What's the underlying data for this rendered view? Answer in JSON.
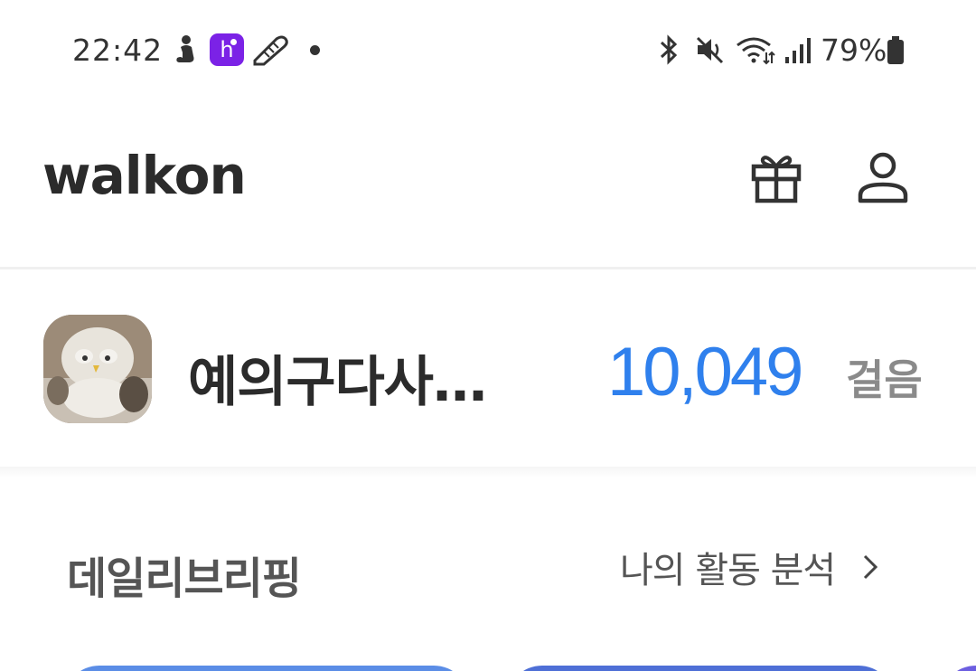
{
  "status_bar": {
    "time": "22:42",
    "notification_icons": [
      "figure-icon",
      "h-app-icon",
      "shoe-icon",
      "dot-icon"
    ],
    "h_app_letter": "h",
    "system_icons": [
      "bluetooth-icon",
      "mute-icon",
      "wifi-icon",
      "signal-icon"
    ],
    "battery_percent": "79%",
    "colors": {
      "h_app": "#7b22e6",
      "text": "#333333"
    }
  },
  "header": {
    "logo": "walkon",
    "icons": [
      "gift-icon",
      "user-icon"
    ]
  },
  "profile": {
    "avatar_alt": "avatar",
    "username": "예의구다사…",
    "steps": "10,049",
    "steps_unit": "걸음",
    "colors": {
      "steps": "#2f80ed"
    }
  },
  "daily_briefing": {
    "title": "데일리브리핑",
    "analysis_link": "나의 활동 분석",
    "chevron_icon": "chevron-right-icon"
  }
}
